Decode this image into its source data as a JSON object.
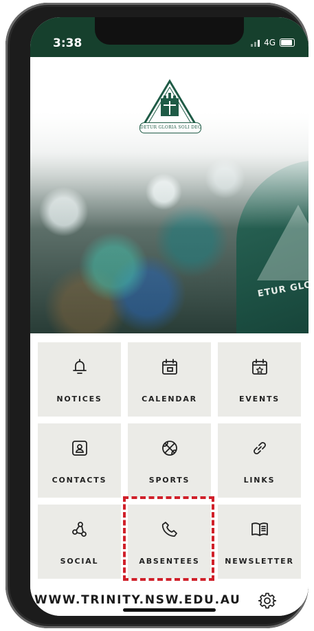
{
  "status_bar": {
    "time": "3:38",
    "network": "4G"
  },
  "hero": {
    "motto": "DETUR GLORIA SOLI DEO",
    "blazer_text": "ETUR GLORIA·SOL"
  },
  "tiles": [
    {
      "label": "NOTICES",
      "icon": "bell-icon"
    },
    {
      "label": "CALENDAR",
      "icon": "calendar-icon"
    },
    {
      "label": "EVENTS",
      "icon": "calendar-star-icon"
    },
    {
      "label": "CONTACTS",
      "icon": "contact-card-icon"
    },
    {
      "label": "SPORTS",
      "icon": "basketball-icon"
    },
    {
      "label": "LINKS",
      "icon": "link-icon"
    },
    {
      "label": "SOCIAL",
      "icon": "social-network-icon"
    },
    {
      "label": "ABSENTEES",
      "icon": "phone-icon"
    },
    {
      "label": "NEWSLETTER",
      "icon": "book-icon"
    }
  ],
  "footer": {
    "url": "WWW.TRINITY.NSW.EDU.AU",
    "settings_icon": "gear-icon"
  },
  "colors": {
    "status_bar": "#16402d",
    "tile_bg": "#ebebe7",
    "highlight": "#d0202a",
    "crest_green": "#1f5b46"
  }
}
